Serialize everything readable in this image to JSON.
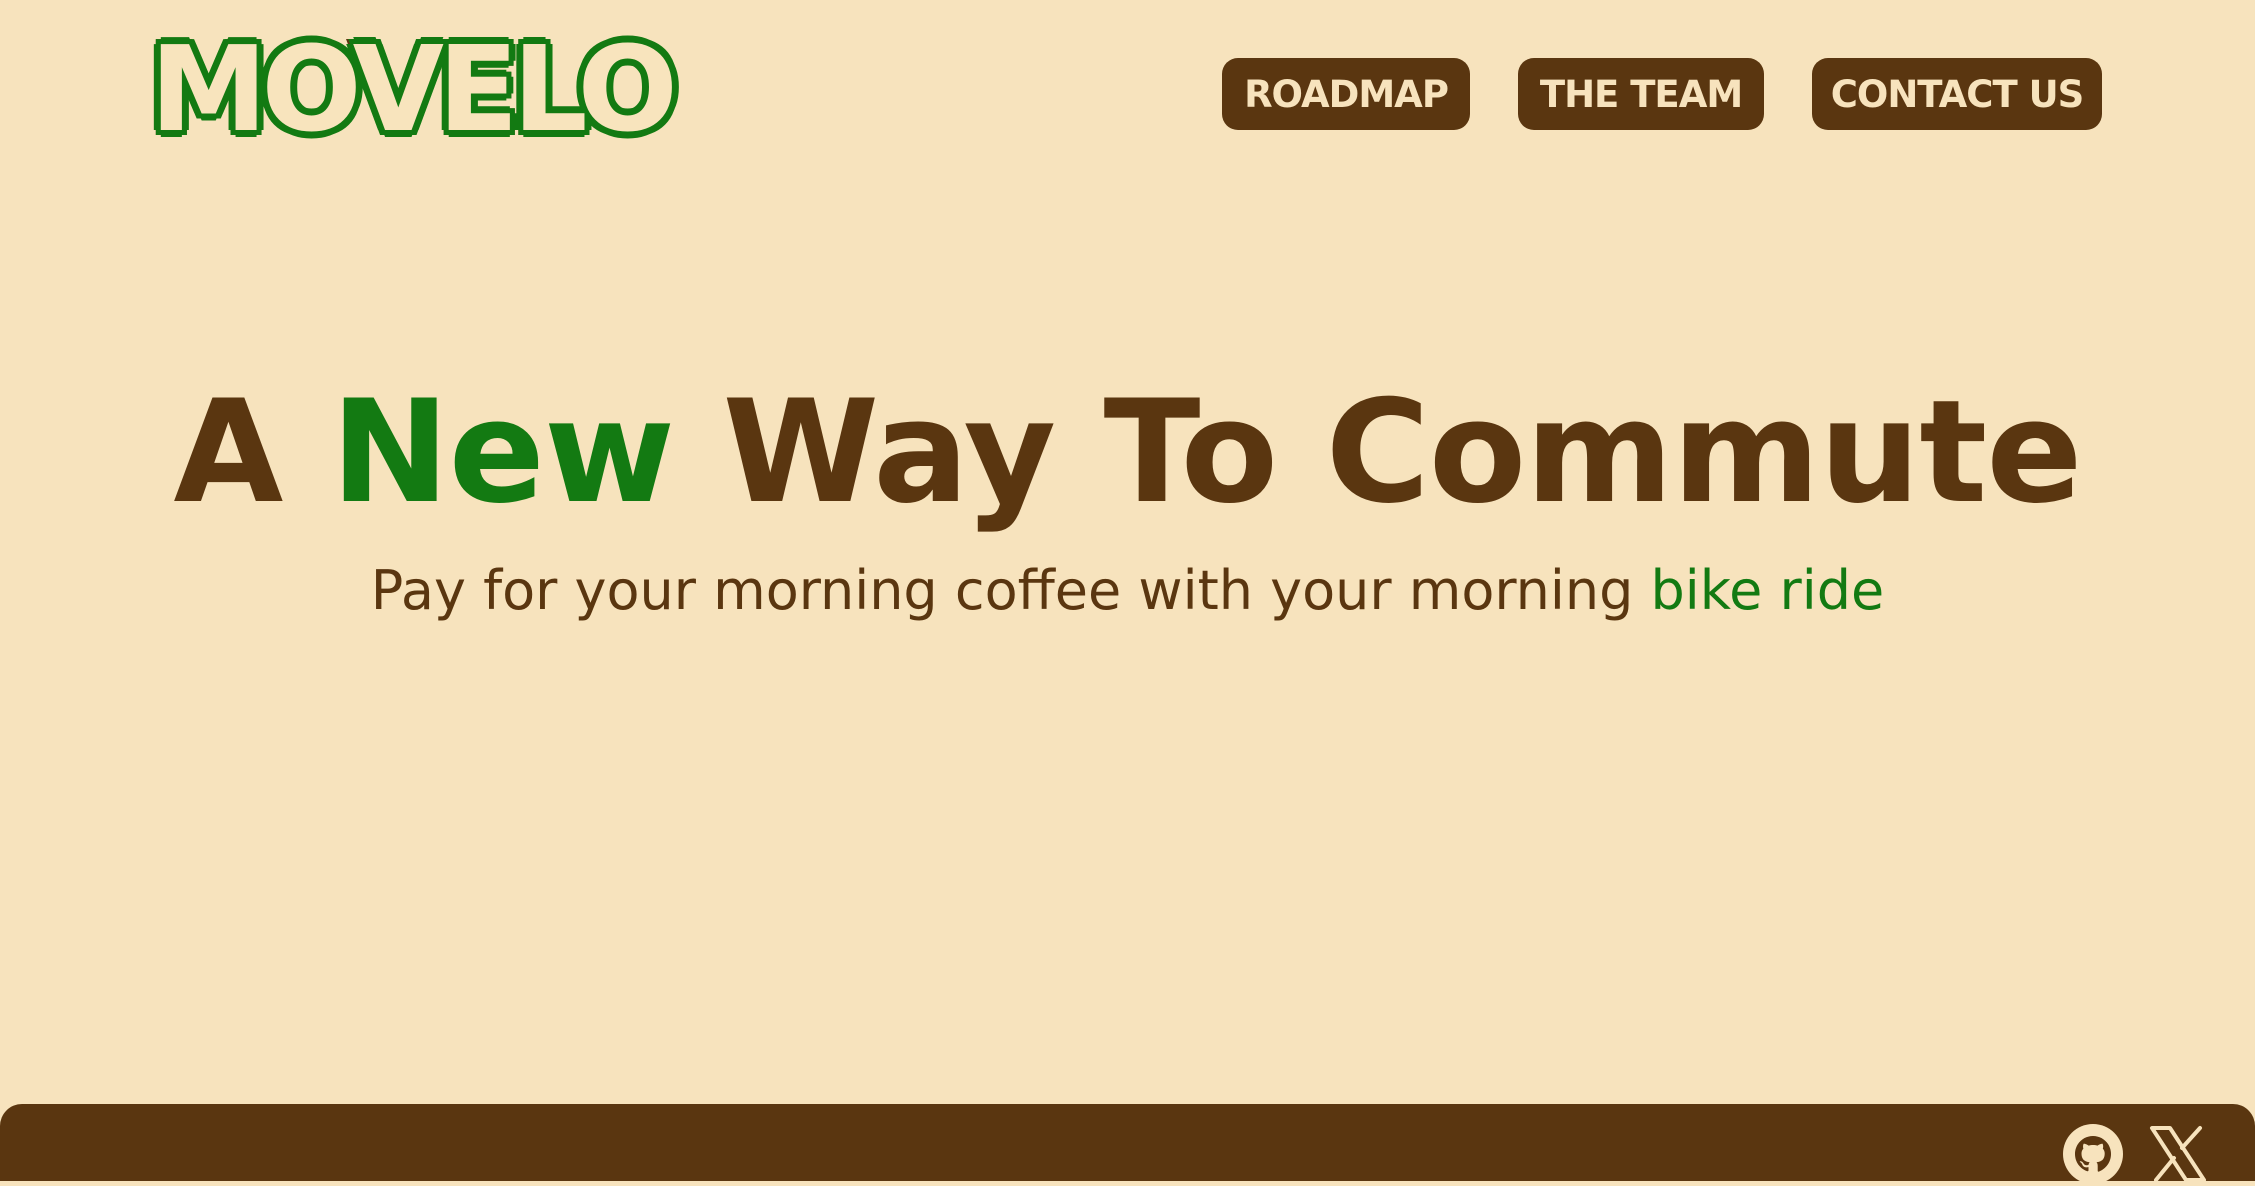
{
  "brand": {
    "logo_text": "MOVELO"
  },
  "nav": {
    "roadmap": "ROADMAP",
    "team": "THE TEAM",
    "contact": "CONTACT US"
  },
  "hero": {
    "title_part1": "A ",
    "title_accent": "New",
    "title_part2": " Way To Commute",
    "subtitle_part1": "Pay for your morning coffee with your morning ",
    "subtitle_accent": "bike ride"
  },
  "footer": {
    "icons": [
      "github-icon",
      "x-icon"
    ]
  },
  "colors": {
    "background": "#f7e3bd",
    "brown": "#5a3610",
    "green": "#137a12"
  }
}
